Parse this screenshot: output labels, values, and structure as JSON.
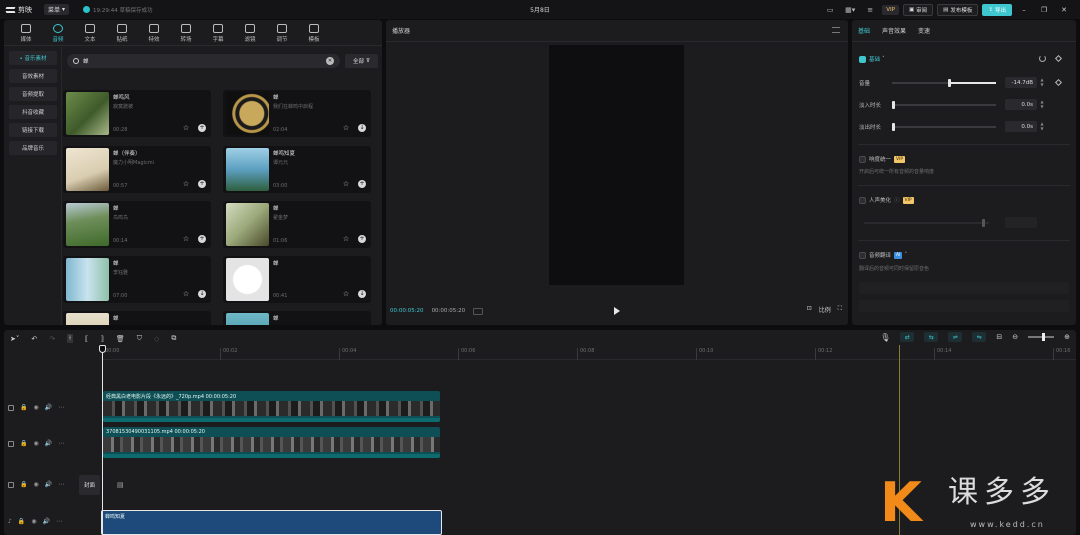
{
  "titlebar": {
    "app_name": "剪映",
    "menu_label": "菜单",
    "autosave": "19:29:44 草稿保存成功",
    "project_title": "5月8日",
    "vip_label": "VIP",
    "review_label": "审阅",
    "publish_label": "发布模板",
    "export_label": "导出"
  },
  "categories": [
    {
      "label": "媒体"
    },
    {
      "label": "音频"
    },
    {
      "label": "文本"
    },
    {
      "label": "贴纸"
    },
    {
      "label": "特效"
    },
    {
      "label": "转场"
    },
    {
      "label": "字幕"
    },
    {
      "label": "滤镜"
    },
    {
      "label": "调节"
    },
    {
      "label": "模板"
    }
  ],
  "side_nav": [
    {
      "label": "• 音乐素材"
    },
    {
      "label": "音效素材"
    },
    {
      "label": "音频提取"
    },
    {
      "label": "抖音收藏"
    },
    {
      "label": "链接下载"
    },
    {
      "label": "品牌音乐"
    }
  ],
  "search": {
    "value": "蝉"
  },
  "filter": {
    "label": "全部"
  },
  "music": [
    {
      "title": "蝉鸣风",
      "artist": "寂寞蹭被",
      "duration": "00:28"
    },
    {
      "title": "蝉",
      "artist": "我们在蝉鸣中启程",
      "duration": "02:04"
    },
    {
      "title": "蝉（伴奏）",
      "artist": "魔力小明Magicmi",
      "duration": "00:57"
    },
    {
      "title": "蝉鸣知夏",
      "artist": "谭元元",
      "duration": "03:00"
    },
    {
      "title": "蝉",
      "artist": "鸟鸣鸟",
      "duration": "00:14"
    },
    {
      "title": "蝉",
      "artist": "翟金梦",
      "duration": "01:06"
    },
    {
      "title": "蝉",
      "artist": "李钰雅",
      "duration": "07:00"
    },
    {
      "title": "蝉",
      "artist": "",
      "duration": "00:41"
    },
    {
      "title": "蝉",
      "artist": "",
      "duration": ""
    },
    {
      "title": "蝉",
      "artist": "",
      "duration": ""
    }
  ],
  "player": {
    "title": "播放器",
    "current_time": "00:00:05:20",
    "total_time": "00:00:05:20",
    "ratio_label": "比例"
  },
  "right_panel": {
    "tabs": [
      "基础",
      "声音效果",
      "变速"
    ],
    "basic_label": "基础",
    "volume_label": "音量",
    "volume_value": "-14.7dB",
    "fade_in_label": "淡入时长",
    "fade_in_value": "0.0s",
    "fade_out_label": "淡出时长",
    "fade_out_value": "0.0s",
    "loudness_label": "响度统一",
    "loudness_desc": "开启后可统一所有音频的音量响度",
    "vocal_label": "人声美化",
    "translate_label": "音频翻译",
    "translate_desc": "翻译后的音频可同时保留原音色",
    "vip_badge": "VIP",
    "ai_badge": "AI"
  },
  "timeline": {
    "ruler": [
      "00:00",
      "00:02",
      "00:04",
      "00:06",
      "00:08",
      "00:10",
      "00:12",
      "00:14",
      "00:16"
    ],
    "clip1_label": "经典黑白老电影片段《永远的》_720p.mp4  00:00:05:20",
    "clip2_label": "3708153049003110​5.mp4  00:00:05:20",
    "cover_label": "封面",
    "audio_label": "蝉鸣知夏"
  },
  "watermark": {
    "k": "K",
    "text": "课多多",
    "url": "www.kedd.cn"
  },
  "colors": {
    "accent": "#3ec7cf",
    "vip": "#f4c66a",
    "watermark_orange": "#f18a19"
  }
}
